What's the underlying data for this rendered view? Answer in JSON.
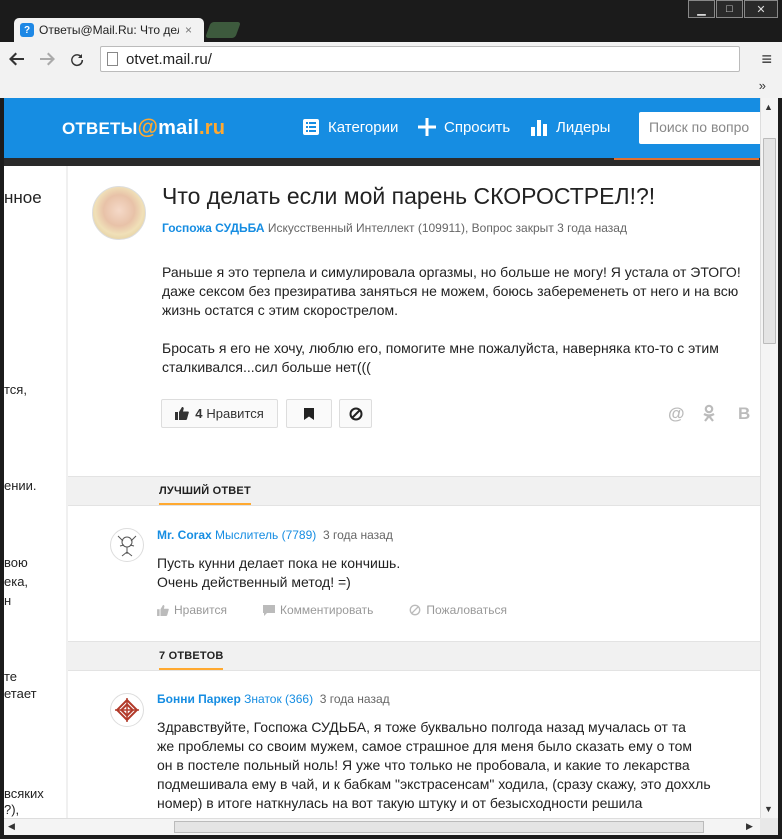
{
  "browser": {
    "tab_title": "Ответы@Mail.Ru: Что дела",
    "tab_close": "×",
    "url": "otvet.mail.ru/",
    "window_buttons": [
      "▁",
      "□",
      "✕"
    ],
    "menu_icon": "≡",
    "bookmarks_chevron": "»"
  },
  "header": {
    "logo_prefix": "ОТВЕТЫ",
    "logo_at": "@",
    "logo_mail": "mail",
    "logo_dot": ".",
    "logo_ru": "ru",
    "nav": [
      {
        "label": "Категории",
        "icon": "list-icon"
      },
      {
        "label": "Спросить",
        "icon": "plus-icon"
      },
      {
        "label": "Лидеры",
        "icon": "bar-chart-icon"
      }
    ],
    "search_placeholder": "Поиск по вопро"
  },
  "left_column_fragments": [
    "нное",
    "тся,",
    "ении.",
    "вою",
    "ека,",
    "н",
    "те",
    "етает",
    "всяких",
    "?),"
  ],
  "question": {
    "title": "Что делать если мой парень СКОРОСТРЕЛ!?!",
    "author": "Госпожа СУДЬБА",
    "meta": "Искусственный Интеллект (109911), Вопрос закрыт 3 года назад",
    "body_lines_1": [
      "Раньше я это терпела и симулировала оргазмы, но больше не могу! Я устала от ЭТОГО!",
      "даже сексом без презиратива заняться не можем, боюсь забеременеть от него и на всю",
      "жизнь остатся с этим скорострелом."
    ],
    "body_lines_2": [
      "Бросать я его не хочу, люблю его, помогите мне пожалуйста, наверняка кто-то с этим",
      "сталкивался...сил больше нет((("
    ],
    "like_count": "4",
    "like_label": "Нравится",
    "share_icons": [
      "@",
      "ok",
      "B"
    ]
  },
  "best_answer": {
    "section_label": "ЛУЧШИЙ ОТВЕТ",
    "author": "Mr. Corax",
    "rank": "Мыслитель (7789)",
    "time": "3 года назад",
    "lines": [
      "Пусть кунни делает пока не кончишь.",
      "Очень действенный метод! =)"
    ],
    "actions": [
      "Нравится",
      "Комментировать",
      "Пожаловаться"
    ]
  },
  "answers": {
    "section_label": "7 ОТВЕТОВ",
    "first": {
      "author": "Бонни Паркер",
      "rank": "Знаток (366)",
      "time": "3 года назад",
      "lines": [
        "Здравствуйте, Госпожа СУДЬБА, я тоже буквально полгода назад мучалась от та",
        "же проблемы со своим мужем, самое страшное для меня было сказать ему о том",
        "он в постеле польный ноль! Я уже что только не пробовала, и какие то лекарства",
        "подмешивала ему в чай, и к бабкам \"экстрасенсам\" ходила, (сразу скажу, это доххль",
        "номер) в итоге наткнулась на вот такую штуку и от безысходности решила"
      ]
    }
  },
  "colors": {
    "brand_blue": "#168de2",
    "accent_orange": "#ffa930"
  }
}
